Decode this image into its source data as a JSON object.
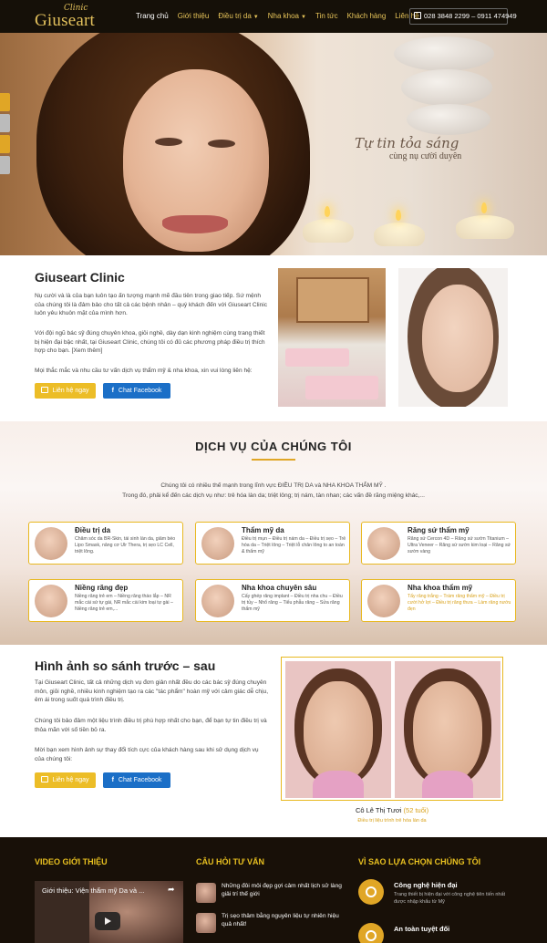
{
  "header": {
    "logo_clinic": "Clinic",
    "logo_brand": "Giuseart",
    "nav": [
      {
        "label": "Trang chủ",
        "dropdown": false
      },
      {
        "label": "Giới thiệu",
        "dropdown": false
      },
      {
        "label": "Điều trị da",
        "dropdown": true
      },
      {
        "label": "Nha khoa",
        "dropdown": true
      },
      {
        "label": "Tin tức",
        "dropdown": false
      },
      {
        "label": "Khách hàng",
        "dropdown": false
      },
      {
        "label": "Liên hệ",
        "dropdown": false
      }
    ],
    "phone": "028 3848 2299 – 0911 474949"
  },
  "hero": {
    "tagline": "Tự tin tỏa sáng",
    "subtagline": "cùng nụ cười duyên"
  },
  "intro": {
    "title": "Giuseart Clinic",
    "p1": "Nụ cười và là của bạn luôn tạo ấn tượng mạnh mẽ đầu tiên trong giao tiếp. Sứ mệnh của chúng tôi là đảm bảo cho tất cả các bệnh nhân – quý khách đến với Giuseart Clinic luôn yêu khuôn mặt của mình hơn.",
    "p2": "Với đội ngũ bác sỹ đúng chuyên khoa, giỏi nghề, dày dạn kinh nghiệm cùng trang thiết bị hiện đại bậc nhất, tại Giuseart Clinic, chúng tôi có đủ các phương pháp điều trị thích hợp cho bạn. [Xem thêm]",
    "p3": "Mọi thắc mắc và nhu cầu tư vấn dịch vụ thẩm mỹ & nha khoa, xin vui lòng liên hệ:",
    "contact_btn": "Liên hệ ngay",
    "facebook_btn": "Chat Facebook"
  },
  "services": {
    "title": "DỊCH VỤ CỦA CHÚNG TÔI",
    "desc1": "Chúng tôi có nhiều thế mạnh trong lĩnh vực  ĐIỀU TRỊ DA  và  NHA KHOA THẨM MỸ .",
    "desc2": "Trong đó, phải kể đến các dịch vụ như: trẻ hóa làn da; triệt lông; trị nám, tàn nhan; các vấn đề răng miệng khác,...",
    "cards": [
      {
        "title": "Điều trị da",
        "desc": "Chăm sóc da BR-Skin, tái sinh làn da, giảm béo Lipo Smask, nâng cơ Ulr Thera, trị sẹo LC Cell, triệt lông.",
        "highlight": false
      },
      {
        "title": "Thẩm mỹ da",
        "desc": "Điều trị mụn – Điều trị nám da – Điều trị sẹo – Trẻ hóa da – Triệt lông – Triệt lỗ chân lông to an toàn & thẩm mỹ",
        "highlight": false
      },
      {
        "title": "Răng sứ thẩm mỹ",
        "desc": "Răng sứ Cercon 4D – Răng sứ sườn Titanium – Ultra Veneer – Răng sứ sườn kim loại – Răng sứ sườn vàng",
        "highlight": false
      },
      {
        "title": "Niềng răng đẹp",
        "desc": "Niềng răng trẻ em – Niềng răng tháo lắp – NR mắc cài sứ tự gài, NR mắc cài kim loại tự gài – Niềng răng trẻ em,...",
        "highlight": false
      },
      {
        "title": "Nha khoa chuyên sâu",
        "desc": "Cấy ghép răng implant – Điều trị nha chu – Điều trị tủy – Nhổ răng – Tiểu phẫu răng – Sửa răng thẩm mỹ",
        "highlight": false
      },
      {
        "title": "Nha khoa thẩm mỹ",
        "desc": "Tẩy răng trắng – Trám răng thẩm mỹ – Điều trị cười hở lợi – Điều trị răng thưa – Làm răng nướu đẹn",
        "highlight": true
      }
    ]
  },
  "before_after": {
    "title": "Hình ảnh so sánh trước – sau",
    "p1": "Tại Giuseart Clinic, tất cả những dịch vụ đơn giản nhất đều do các bác sỹ đúng chuyên môn, giỏi nghề, nhiều kinh nghiệm tạo ra các \"tác phẩm\" hoàn mỹ với cảm giác dễ chịu, êm ái trong suốt quá trình điều trị.",
    "p2": "Chúng tôi bảo đảm một liệu trình điều trị phù hợp nhất cho bạn, để bạn tự tin điều trị và thỏa mãn với số tiền bỏ ra.",
    "p3": "Mời bạn xem hình ảnh sự thay đổi tích cực của khách hàng sau khi sử dụng dịch vụ của chúng tôi:",
    "contact_btn": "Liên hệ ngay",
    "facebook_btn": "Chat Facebook",
    "customer_name": "Cô Lê Thị Tươi",
    "customer_age": "(52 tuổi)",
    "customer_service": "Điều trị liệu trình trẻ hóa làn da"
  },
  "footer": {
    "video_title": "VIDEO GIỚI THIỆU",
    "video_caption": "Giới thiệu: Viện thẩm mỹ Da và ...",
    "faq_title": "CÂU HỎI TƯ VẤN",
    "faq": [
      "Những đôi môi đẹp gợi cảm nhất lịch sử làng giải trí thế giới",
      "Trị sẹo thâm bằng nguyên liệu tự nhiên hiệu quả nhất!"
    ],
    "why_title": "VÌ SAO LỰA CHỌN CHÚNG TÔI",
    "why": [
      {
        "title": "Công nghệ hiện đại",
        "desc": "Trang thiết bị hiện đại với công nghệ tiên tiến nhất được nhập khẩu từ Mỹ"
      },
      {
        "title": "An toàn tuyệt đối",
        "desc": ""
      }
    ]
  },
  "colors": {
    "accent": "#e0a626",
    "header_bg": "#151008",
    "facebook": "#1b6fc7"
  }
}
